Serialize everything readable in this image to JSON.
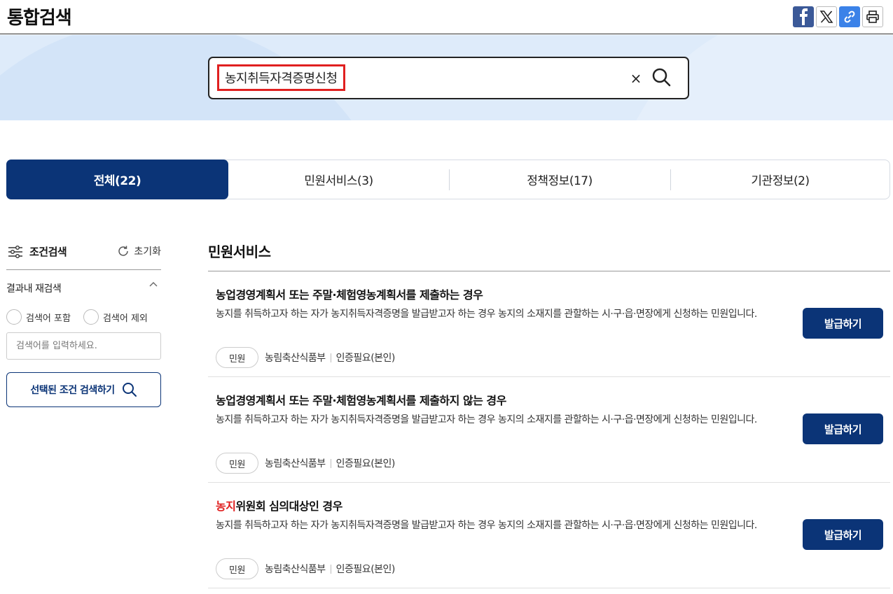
{
  "header": {
    "title": "통합검색",
    "share": [
      "facebook-icon",
      "x-icon",
      "link-icon",
      "print-icon"
    ]
  },
  "search": {
    "query": "농지취득자격증명신청",
    "clear_label": "×"
  },
  "tabs": [
    {
      "label": "전체(22)",
      "active": true
    },
    {
      "label": "민원서비스(3)",
      "active": false
    },
    {
      "label": "정책정보(17)",
      "active": false
    },
    {
      "label": "기관정보(2)",
      "active": false
    }
  ],
  "sidebar": {
    "filter_title": "조건검색",
    "reset_label": "초기화",
    "refine_title": "결과내 재검색",
    "radio_include": "검색어 포함",
    "radio_exclude": "검색어 제외",
    "input_placeholder": "검색어를 입력하세요.",
    "apply_label": "선택된 조건 검색하기"
  },
  "results": {
    "section_title": "민원서비스",
    "items": [
      {
        "title_pre": "",
        "title_highlight": "",
        "title_post": "농업경영계획서 또는 주말·체험영농계획서를 제출하는 경우",
        "desc": "농지를 취득하고자 하는 자가 농지취득자격증명을 발급받고자 하는 경우 농지의 소재지를 관할하는 시·구·읍·면장에게 신청하는 민원입니다.",
        "tag": "민원",
        "agency": "농림축산식품부",
        "auth": "인증필요(본인)",
        "button": "발급하기"
      },
      {
        "title_pre": "",
        "title_highlight": "",
        "title_post": "농업경영계획서 또는 주말·체험영농계획서를 제출하지 않는 경우",
        "desc": "농지를 취득하고자 하는 자가 농지취득자격증명을 발급받고자 하는 경우 농지의 소재지를 관할하는 시·구·읍·면장에게 신청하는 민원입니다.",
        "tag": "민원",
        "agency": "농림축산식품부",
        "auth": "인증필요(본인)",
        "button": "발급하기"
      },
      {
        "title_pre": "",
        "title_highlight": "농지",
        "title_post": "위원회 심의대상인 경우",
        "desc": "농지를 취득하고자 하는 자가 농지취득자격증명을 발급받고자 하는 경우 농지의 소재지를 관할하는 시·구·읍·면장에게 신청하는 민원입니다.",
        "tag": "민원",
        "agency": "농림축산식품부",
        "auth": "인증필요(본인)",
        "button": "발급하기"
      }
    ]
  },
  "colors": {
    "primary": "#0b3477",
    "highlight": "#e02020",
    "banner": "#deebfa"
  }
}
